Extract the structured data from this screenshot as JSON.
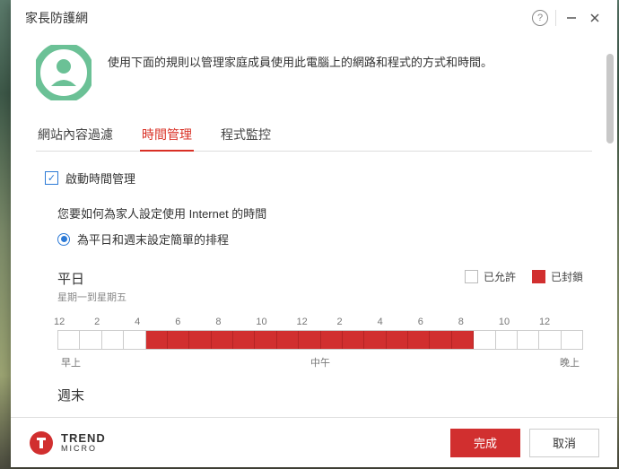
{
  "window": {
    "title": "家長防護網"
  },
  "intro": "使用下面的規則以管理家庭成員使用此電腦上的網路和程式的方式和時間。",
  "tabs": [
    {
      "label": "網站內容過濾",
      "active": false
    },
    {
      "label": "時間管理",
      "active": true
    },
    {
      "label": "程式監控",
      "active": false
    }
  ],
  "enable_checkbox_label": "啟動時間管理",
  "question": "您要如何為家人設定使用 Internet 的時間",
  "radio_option": "為平日和週末設定簡單的排程",
  "legend": {
    "allowed": "已允許",
    "blocked": "已封鎖"
  },
  "weekday": {
    "title": "平日",
    "subtitle": "星期一到星期五"
  },
  "weekend": {
    "title": "週末"
  },
  "hour_ticks": [
    "12",
    "2",
    "4",
    "6",
    "8",
    "10",
    "12",
    "2",
    "4",
    "6",
    "8",
    "10",
    "12"
  ],
  "periods": {
    "morning": "早上",
    "noon": "中午",
    "evening": "晚上"
  },
  "schedule_blocked_hours": [
    4,
    5,
    6,
    7,
    8,
    9,
    10,
    11,
    12,
    13,
    14,
    15,
    16,
    17,
    18
  ],
  "footer": {
    "brand_top": "TREND",
    "brand_bottom": "MICRO",
    "done": "完成",
    "cancel": "取消"
  },
  "chart_data": {
    "type": "bar",
    "title": "平日 星期一到星期五",
    "categories_hours": [
      0,
      1,
      2,
      3,
      4,
      5,
      6,
      7,
      8,
      9,
      10,
      11,
      12,
      13,
      14,
      15,
      16,
      17,
      18,
      19,
      20,
      21,
      22,
      23
    ],
    "series": [
      {
        "name": "已封鎖",
        "blocked_hours": [
          4,
          5,
          6,
          7,
          8,
          9,
          10,
          11,
          12,
          13,
          14,
          15,
          16,
          17,
          18
        ]
      }
    ],
    "legend": [
      "已允許",
      "已封鎖"
    ]
  }
}
